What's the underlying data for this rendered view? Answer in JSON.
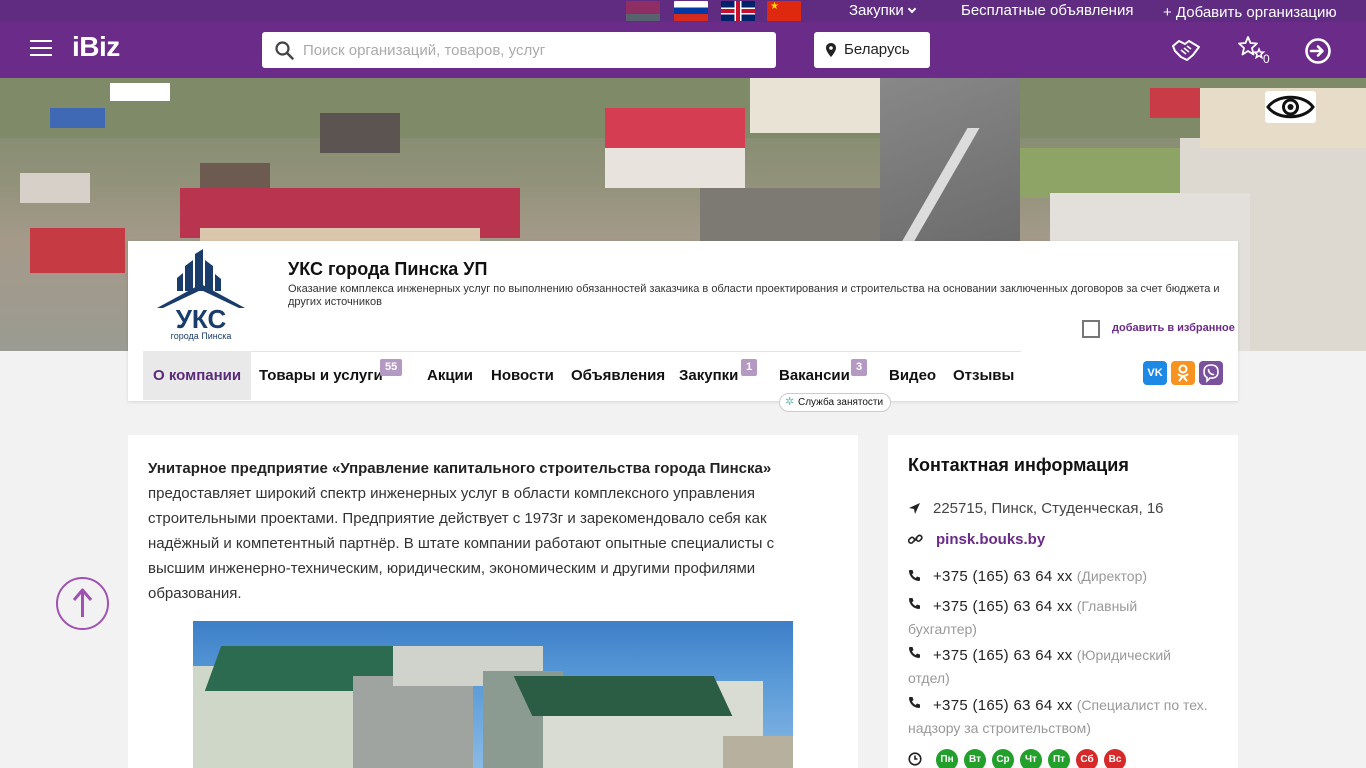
{
  "topbar": {
    "flags": [
      "by-flag",
      "ru-flag",
      "gb-flag",
      "cn-flag"
    ],
    "purchases_label": "Закупки",
    "free_ads_label": "Бесплатные объявления",
    "add_org_label": "+ Добавить организацию"
  },
  "header": {
    "logo": "iBiz",
    "search_placeholder": "Поиск организаций, товаров, услуг",
    "region": "Беларусь",
    "favorites_count": "0",
    "icons": [
      "menu-icon",
      "search-icon",
      "location-pin-icon",
      "handshake-icon",
      "stars-icon",
      "login-icon"
    ]
  },
  "colors": {
    "brand": "#6b2b88",
    "topbar": "#5f2c82",
    "badge": "#b49ac3",
    "accent": "#a052b2"
  },
  "company": {
    "logo_main": "УКС",
    "logo_sub": "города Пинска",
    "title": "УКС города Пинска УП",
    "description": "Оказание комплекса инженерных услуг по выполнению обязанностей заказчика в области проектирования и строительства на основании заключенных договоров за счет бюджета и других источников",
    "favorite_label": "добавить в избранное"
  },
  "tabs": [
    {
      "label": "О компании"
    },
    {
      "label": "Товары и услуги",
      "badge": "55"
    },
    {
      "label": "Акции"
    },
    {
      "label": "Новости"
    },
    {
      "label": "Объявления"
    },
    {
      "label": "Закупки",
      "badge": "1"
    },
    {
      "label": "Вакансии",
      "badge": "3"
    },
    {
      "label": "Видео"
    },
    {
      "label": "Отзывы"
    }
  ],
  "job_service": "Служба занятости",
  "social": {
    "vk": "VK",
    "ok": "OK",
    "viber": "Viber"
  },
  "about": {
    "bold": "Унитарное предприятие «Управление капитального строительства города Пинска»",
    "text": " предоставляет широкий спектр инженерных услуг в области комплексного управления строительными проектами. Предприятие действует с 1973г и зарекомендовало себя как надёжный и компетентный партнёр. В штате компании работают опытные специалисты с высшим инженерно-техническим, юридическим, экономическим и другими профилями образования."
  },
  "contacts": {
    "title": "Контактная информация",
    "address": "225715, Пинск, Студенческая, 16",
    "website": "pinsk.bouks.by",
    "phones": [
      {
        "number": "+375 (165) 63 64 xx",
        "role": "(Директор)"
      },
      {
        "number": "+375 (165) 63 64 xx",
        "role": "(Главный бухгалтер)"
      },
      {
        "number": "+375 (165) 63 64 xx",
        "role": "(Юридический отдел)"
      },
      {
        "number": "+375 (165) 63 64 xx",
        "role": "(Специалист по тех. надзору за строительством)"
      }
    ],
    "days": [
      {
        "label": "Пн",
        "color": "#22a02b"
      },
      {
        "label": "Вт",
        "color": "#22a02b"
      },
      {
        "label": "Ср",
        "color": "#22a02b"
      },
      {
        "label": "Чт",
        "color": "#22a02b"
      },
      {
        "label": "Пт",
        "color": "#22a02b"
      },
      {
        "label": "Сб",
        "color": "#d62a2a"
      },
      {
        "label": "Вс",
        "color": "#d62a2a"
      }
    ]
  }
}
